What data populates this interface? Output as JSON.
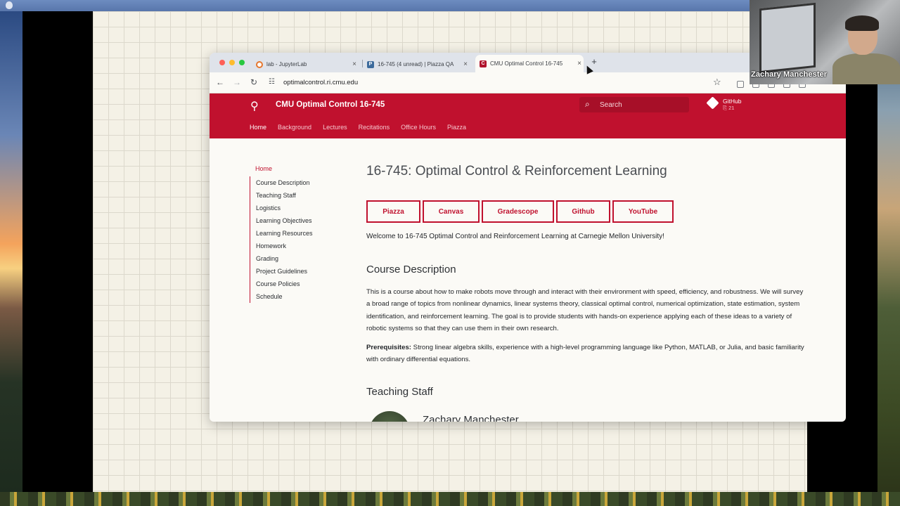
{
  "browser": {
    "tabs": [
      {
        "label": "lab - JupyterLab",
        "close": "×"
      },
      {
        "label": "16-745 (4 unread) | Piazza QA",
        "close": "×"
      },
      {
        "label": "CMU Optimal Control 16-745",
        "close": "×"
      }
    ],
    "new_tab": "+",
    "url": "optimalcontrol.ri.cmu.edu"
  },
  "webcam": {
    "name": "Zachary Manchester"
  },
  "site": {
    "title": "CMU Optimal Control 16-745",
    "search_placeholder": "Search",
    "github_label": "GitHub",
    "github_count": "21",
    "nav": [
      "Home",
      "Background",
      "Lectures",
      "Recitations",
      "Office Hours",
      "Piazza"
    ],
    "active_nav": "Home"
  },
  "toc": {
    "home": "Home",
    "items": [
      "Course Description",
      "Teaching Staff",
      "Logistics",
      "Learning Objectives",
      "Learning Resources",
      "Homework",
      "Grading",
      "Project Guidelines",
      "Course Policies",
      "Schedule"
    ]
  },
  "content": {
    "title": "16-745: Optimal Control & Reinforcement Learning",
    "buttons": [
      "Piazza",
      "Canvas",
      "Gradescope",
      "Github",
      "YouTube"
    ],
    "welcome": "Welcome to 16-745 Optimal Control and Reinforcement Learning at Carnegie Mellon University!",
    "course_description_heading": "Course Description",
    "course_description": "This is a course about how to make robots move through and interact with their environment with speed, efficiency, and robustness. We will survey a broad range of topics from nonlinear dynamics, linear systems theory, classical optimal control, numerical optimization, state estimation, system identification, and reinforcement learning. The goal is to provide students with hands-on experience applying each of these ideas to a variety of robotic systems so that they can use them in their own research.",
    "prereq_label": "Prerequisites:",
    "prereq_text": " Strong linear algebra skills, experience with a high-level programming language like Python, MATLAB, or Julia, and basic familiarity with ordinary differential equations.",
    "teaching_staff_heading": "Teaching Staff",
    "staff_name": "Zachary Manchester"
  },
  "colors": {
    "brand_red": "#c0112e",
    "page_bg": "#fbfaf6",
    "grid_paper": "#f4f1e6"
  }
}
